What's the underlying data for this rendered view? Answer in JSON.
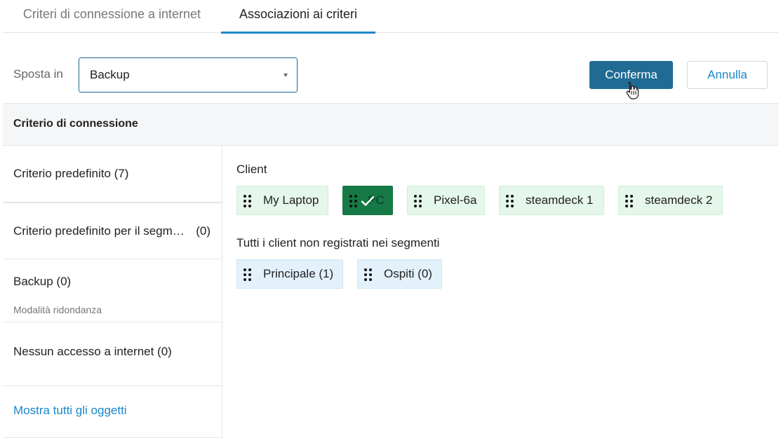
{
  "tabs": [
    {
      "label": "Criteri di connessione a internet"
    },
    {
      "label": "Associazioni ai criteri",
      "active": true
    }
  ],
  "move": {
    "label": "Sposta in",
    "selected": "Backup"
  },
  "buttons": {
    "confirm": "Conferma",
    "cancel": "Annulla"
  },
  "table": {
    "header": "Criterio di connessione"
  },
  "policies": [
    {
      "label": "Criterio predefinito (7)"
    },
    {
      "label": "Criterio predefinito per il segm…",
      "count": "(0)"
    },
    {
      "label": "Backup (0)",
      "sub": "Modalità ridondanza"
    },
    {
      "label": "Nessun accesso a internet (0)"
    },
    {
      "label": "Mostra tutti gli oggetti"
    }
  ],
  "clients": {
    "title": "Client",
    "items": [
      {
        "label": "My Laptop"
      },
      {
        "label": "PC",
        "selected": true
      },
      {
        "label": "Pixel-6a"
      },
      {
        "label": "steamdeck 1"
      },
      {
        "label": "steamdeck 2"
      }
    ]
  },
  "segments": {
    "title": "Tutti i client non registrati nei segmenti",
    "items": [
      {
        "label": "Principale (1)"
      },
      {
        "label": "Ospiti (0)"
      }
    ]
  },
  "icons": {
    "grip": "drag-handle-icon",
    "check": "check-icon",
    "caret": "caret-down-icon",
    "cursor": "hand-pointer-icon"
  },
  "colors": {
    "accent": "#1a87c8",
    "primary_button": "#1f6b94",
    "client_chip": "#e5f6ea",
    "segment_chip": "#e3f1fb",
    "selected_chip": "#157a45"
  }
}
